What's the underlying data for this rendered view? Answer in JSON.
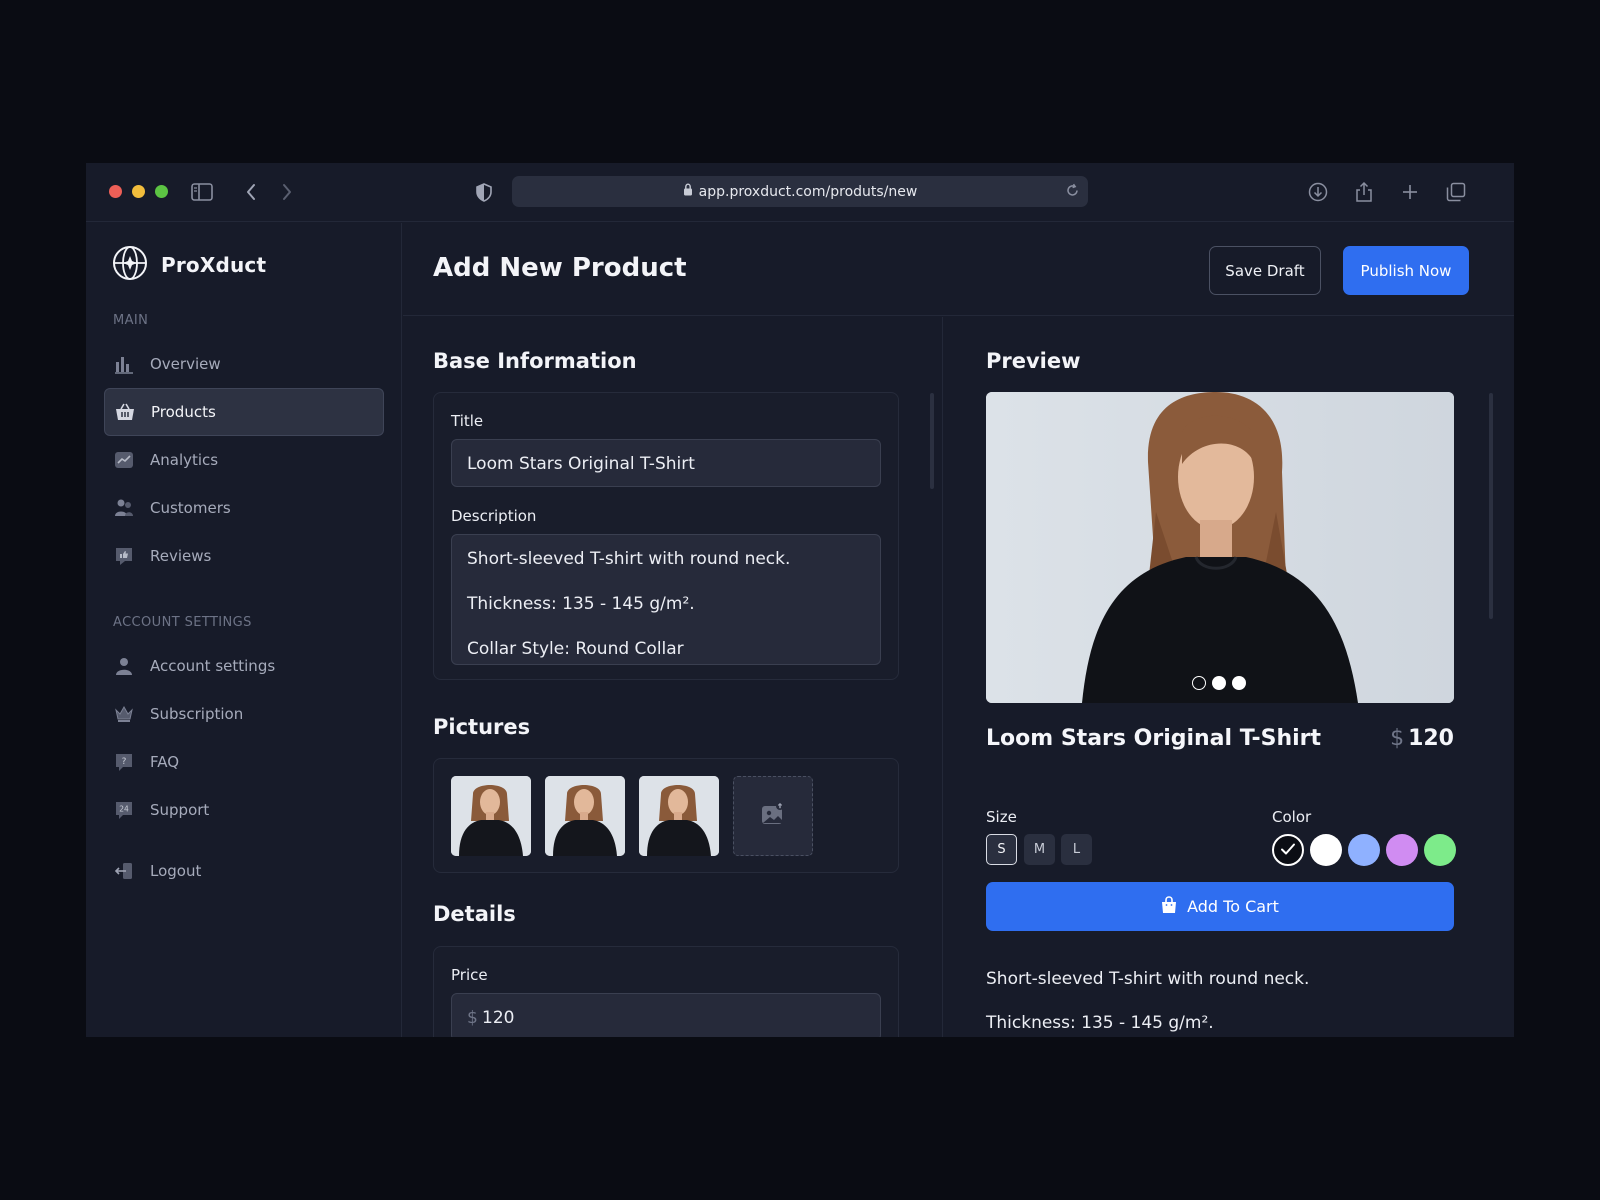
{
  "browser": {
    "url": "app.proxduct.com/produts/new"
  },
  "brand": {
    "name": "ProXduct"
  },
  "sidebar": {
    "main_label": "MAIN",
    "items": [
      {
        "label": "Overview",
        "icon": "bar-chart-icon",
        "active": false
      },
      {
        "label": "Products",
        "icon": "basket-icon",
        "active": true
      },
      {
        "label": "Analytics",
        "icon": "trend-icon",
        "active": false
      },
      {
        "label": "Customers",
        "icon": "users-icon",
        "active": false
      },
      {
        "label": "Reviews",
        "icon": "thumbs-up-icon",
        "active": false
      }
    ],
    "account_label": "ACCOUNT SETTINGS",
    "account_items": [
      {
        "label": "Account settings",
        "icon": "person-icon"
      },
      {
        "label": "Subscription",
        "icon": "crown-icon"
      },
      {
        "label": "FAQ",
        "icon": "question-chat-icon"
      },
      {
        "label": "Support",
        "icon": "support-24-icon"
      }
    ],
    "logout_label": "Logout"
  },
  "header": {
    "title": "Add New Product",
    "save_draft": "Save Draft",
    "publish": "Publish Now"
  },
  "form": {
    "base_title": "Base Information",
    "title_label": "Title",
    "title_value": "Loom Stars Original T-Shirt",
    "description_label": "Description",
    "description_lines": [
      "Short-sleeved T-shirt with round neck.",
      "Thickness: 135 - 145 g/m².",
      "Collar Style: Round Collar"
    ],
    "pictures_title": "Pictures",
    "details_title": "Details",
    "price_label": "Price",
    "price_currency": "$",
    "price_value": "120"
  },
  "preview": {
    "title": "Preview",
    "product_name": "Loom Stars Original T-Shirt",
    "currency": "$",
    "price": "120",
    "size_label": "Size",
    "sizes": [
      "S",
      "M",
      "L"
    ],
    "selected_size": "S",
    "color_label": "Color",
    "colors": [
      "#0b0d14",
      "#ffffff",
      "#8fb1ff",
      "#d08cf2",
      "#7deb8a"
    ],
    "add_to_cart": "Add To Cart",
    "desc_lines": [
      "Short-sleeved T-shirt with round neck.",
      "Thickness: 135 - 145 g/m²."
    ]
  },
  "colors": {
    "accent": "#2f6ef0",
    "background": "#171b29"
  }
}
